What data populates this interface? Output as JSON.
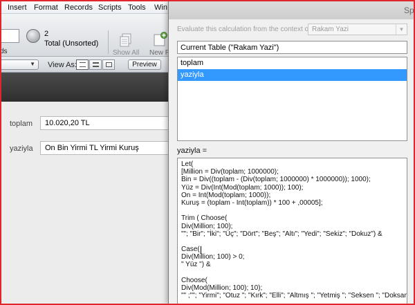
{
  "menubar": {
    "items": [
      "Insert",
      "Format",
      "Records",
      "Scripts",
      "Tools",
      "Win"
    ]
  },
  "toolbar": {
    "records_label": "ds",
    "record_count": "2",
    "total_label": "Total (Unsorted)",
    "show_all_label": "Show All",
    "new_record_label": "New R"
  },
  "layoutbar": {
    "view_as_label": "View As:",
    "preview_label": "Preview"
  },
  "record": {
    "fields": [
      {
        "label": "toplam",
        "value": "10.020,20  TL"
      },
      {
        "label": "yaziyla",
        "value": "On Bin Yirmi TL  Yirmi Kuruş"
      }
    ]
  },
  "dialog": {
    "title": "Sp",
    "evaluate_label": "Evaluate this calculation from the context of:",
    "evaluate_value": "Rakam Yazi",
    "table_select": "Current Table (\"Rakam Yazi\")",
    "fields": [
      "toplam",
      "yaziyla"
    ],
    "selected_field": "yaziyla",
    "calc_label": "yaziyla =",
    "calc_lines": [
      "Let(",
      "[Million = Div(toplam; 1000000);",
      "Bin = Div((toplam - (Div(toplam; 1000000) * 1000000)); 1000);",
      "Yüz = Div(Int(Mod(toplam; 1000)); 100);",
      "On = Int(Mod(toplam; 1000));",
      "Kuruş = (toplam - Int(toplam)) * 100 + ,00005];",
      "",
      "Trim ( Choose(",
      "Div(Million; 100);",
      "\"\"; \"Bir\"; \"İki\"; \"Üç\"; \"Dört\"; \"Beş\"; \"Altı\"; \"Yedi\"; \"Sekiz\"; \"Dokuz\") &",
      "",
      "Case(",
      "Div(Million; 100) > 0;",
      "\" Yüz \") &",
      "",
      "Choose(",
      "Div(Mod(Million; 100); 10);",
      "\"\" ;\"\"; \"Yirmi\"; \"Otuz \"; \"Kırk\"; \"Elli\"; \"Altmış \"; \"Yetmiş \"; \"Seksen \"; \"Doksan \") &"
    ]
  },
  "colors": {
    "frame_border": "#e1262b",
    "selection": "#3399ff",
    "dark_band": "#3a3a3a"
  },
  "icons": {
    "pie": "record-pie-icon",
    "show_all": "show-all-icon",
    "new_record": "new-record-icon",
    "form_view": "form-view-icon",
    "list_view": "list-view-icon",
    "table_view": "table-view-icon"
  }
}
